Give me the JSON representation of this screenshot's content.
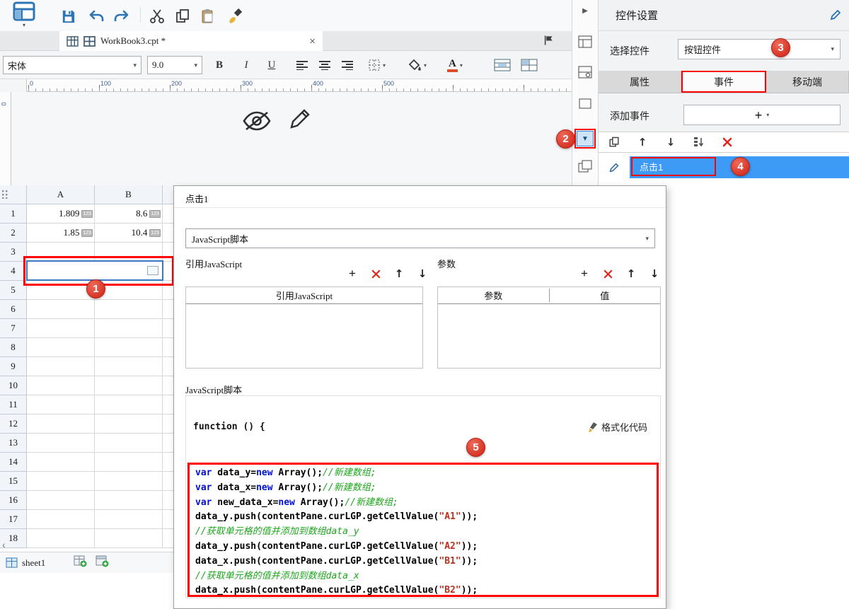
{
  "colors": {
    "accent_blue": "#2e75b6",
    "selection_blue": "#3d9af5",
    "annotation_red": "#d63425",
    "highlight_red": "#fe0000",
    "code_keyword": "#0010d8",
    "code_string": "#c03020",
    "code_comment": "#1ea51e"
  },
  "tabbar": {
    "tab_label": "WorkBook3.cpt *",
    "close_glyph": "×"
  },
  "font_toolbar": {
    "font_name": "宋体",
    "font_size": "9.0",
    "bold": "B",
    "italic": "I",
    "underline": "U",
    "color_letter": "A"
  },
  "ruler": {
    "marks": [
      "0",
      "100",
      "200",
      "300",
      "400",
      "500"
    ],
    "vertical_origin": "0"
  },
  "spreadsheet": {
    "columns": [
      "A",
      "B",
      ""
    ],
    "row_count": 18,
    "cells": [
      {
        "row": 1,
        "col": "A",
        "value": "1.809",
        "badge": "123"
      },
      {
        "row": 1,
        "col": "B",
        "value": "8.6",
        "badge": "123"
      },
      {
        "row": 2,
        "col": "A",
        "value": "1.85",
        "badge": "123"
      },
      {
        "row": 2,
        "col": "B",
        "value": "10.4",
        "badge": "123"
      }
    ],
    "selected_row": 4
  },
  "sheet_bar": {
    "sheet_name": "sheet1",
    "scroll_left_glyph": "‹"
  },
  "right_panel": {
    "title": "控件设置",
    "select_widget_label": "选择控件",
    "widget_value": "按钮控件",
    "tabs": [
      {
        "label": "属性"
      },
      {
        "label": "事件"
      },
      {
        "label": "移动端"
      }
    ],
    "add_event_label": "添加事件",
    "add_plus": "+",
    "event_name": "点击1"
  },
  "dialog": {
    "title": "点击1",
    "script_type": "JavaScript脚本",
    "ref_js_label": "引用JavaScript",
    "ref_js_header": "引用JavaScript",
    "params_label": "参数",
    "param_headers": [
      "参数",
      "值"
    ],
    "js_script_label": "JavaScript脚本",
    "function_line": "function () {",
    "format_code_label": "格式化代码",
    "code_lines": [
      [
        {
          "c": "k",
          "t": "var"
        },
        {
          "c": "p",
          "t": " data_y="
        },
        {
          "c": "k",
          "t": "new"
        },
        {
          "c": "p",
          "t": " Array();"
        },
        {
          "c": "m",
          "t": "//新建数组;"
        }
      ],
      [
        {
          "c": "k",
          "t": "var"
        },
        {
          "c": "p",
          "t": " data_x="
        },
        {
          "c": "k",
          "t": "new"
        },
        {
          "c": "p",
          "t": " Array();"
        },
        {
          "c": "m",
          "t": "//新建数组;"
        }
      ],
      [
        {
          "c": "k",
          "t": "var"
        },
        {
          "c": "p",
          "t": " new_data_x="
        },
        {
          "c": "k",
          "t": "new"
        },
        {
          "c": "p",
          "t": " Array();"
        },
        {
          "c": "m",
          "t": "//新建数组;"
        }
      ],
      [
        {
          "c": "p",
          "t": "data_y.push(contentPane.curLGP.getCellValue("
        },
        {
          "c": "s",
          "t": "\"A1\""
        },
        {
          "c": "p",
          "t": "));"
        }
      ],
      [
        {
          "c": "m",
          "t": "//获取单元格的值并添加到数组data_y"
        }
      ],
      [
        {
          "c": "p",
          "t": "data_y.push(contentPane.curLGP.getCellValue("
        },
        {
          "c": "s",
          "t": "\"A2\""
        },
        {
          "c": "p",
          "t": "));"
        }
      ],
      [
        {
          "c": "p",
          "t": "data_x.push(contentPane.curLGP.getCellValue("
        },
        {
          "c": "s",
          "t": "\"B1\""
        },
        {
          "c": "p",
          "t": "));"
        }
      ],
      [
        {
          "c": "m",
          "t": "//获取单元格的值并添加到数组data_x"
        }
      ],
      [
        {
          "c": "p",
          "t": "data_x.push(contentPane.curLGP.getCellValue("
        },
        {
          "c": "s",
          "t": "\"B2\""
        },
        {
          "c": "p",
          "t": "));"
        }
      ]
    ]
  },
  "annotations": [
    "1",
    "2",
    "3",
    "4",
    "5"
  ]
}
